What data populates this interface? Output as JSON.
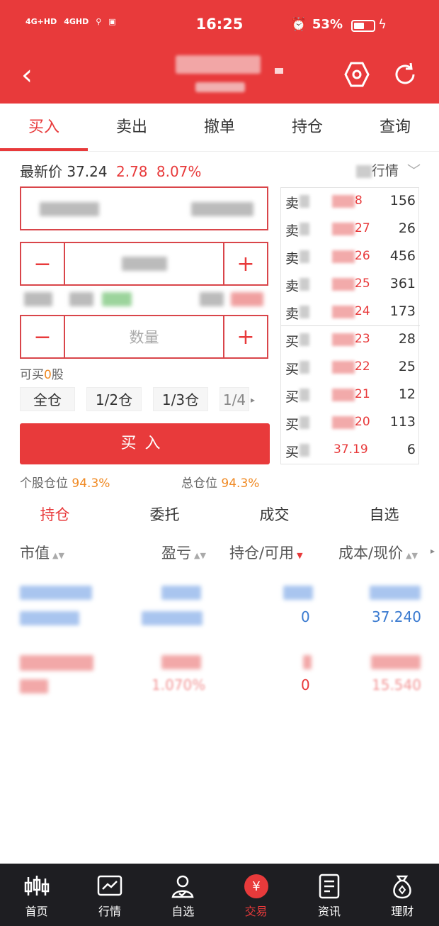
{
  "status_bar": {
    "network1": "4G+HD",
    "network2": "4GHD",
    "time": "16:25",
    "battery": "53%",
    "battery_level": 0.53
  },
  "header": {
    "back_icon": "back-arrow-icon",
    "settings_icon": "hexagon-settings-icon",
    "refresh_icon": "refresh-icon"
  },
  "tabs": [
    {
      "label": "买入"
    },
    {
      "label": "卖出"
    },
    {
      "label": "撤单"
    },
    {
      "label": "持仓"
    },
    {
      "label": "查询"
    }
  ],
  "price": {
    "label": "最新价",
    "last": "37.24",
    "change": "2.78",
    "change_pct": "8.07%",
    "quote_switch": "行情"
  },
  "order_form": {
    "minus": "−",
    "plus": "+",
    "quantity_placeholder": "数量",
    "can_buy_prefix": "可买",
    "can_buy_value": "0",
    "can_buy_suffix": "股",
    "position_buttons": [
      "全仓",
      "1/2仓",
      "1/3仓",
      "1/4"
    ],
    "buy_button": "买入",
    "single_ratio_label": "个股仓位",
    "single_ratio_value": "94.3%",
    "total_ratio_label": "总仓位",
    "total_ratio_value": "94.3%"
  },
  "order_book": {
    "rows": [
      {
        "label": "卖",
        "price_suffix": "8",
        "volume": "156"
      },
      {
        "label": "卖",
        "price_suffix": "27",
        "volume": "26"
      },
      {
        "label": "卖",
        "price_suffix": "26",
        "volume": "456"
      },
      {
        "label": "卖",
        "price_suffix": "25",
        "volume": "361"
      },
      {
        "label": "卖",
        "price_suffix": "24",
        "volume": "173"
      },
      {
        "label": "买",
        "price_suffix": "23",
        "volume": "28"
      },
      {
        "label": "买",
        "price_suffix": "22",
        "volume": "25"
      },
      {
        "label": "买",
        "price_suffix": "21",
        "volume": "12"
      },
      {
        "label": "买",
        "price_suffix": "20",
        "volume": "113"
      },
      {
        "label": "买",
        "price_suffix": "37.19",
        "volume": "6"
      }
    ]
  },
  "portfolio_tabs": [
    {
      "label": "持仓"
    },
    {
      "label": "委托"
    },
    {
      "label": "成交"
    },
    {
      "label": "自选"
    }
  ],
  "columns": {
    "market_value": "市值",
    "pnl": "盈亏",
    "holding": "持仓/可用",
    "cost": "成本/现价"
  },
  "holdings": [
    {
      "available": "0",
      "current_price": "37.240"
    },
    {
      "available": "0",
      "current_price": "15.540",
      "pnl_pct_suffix": "1.070%"
    }
  ],
  "bottom_nav": [
    {
      "label": "首页",
      "icon": "candlestick-icon"
    },
    {
      "label": "行情",
      "icon": "chart-icon"
    },
    {
      "label": "自选",
      "icon": "user-icon"
    },
    {
      "label": "交易",
      "icon": "yuan-icon"
    },
    {
      "label": "资讯",
      "icon": "document-icon"
    },
    {
      "label": "理财",
      "icon": "money-bag-icon"
    }
  ],
  "colors": {
    "brand_red": "#e83a3b",
    "orange": "#f08a24",
    "blue": "#3b7bd0",
    "nav_bg": "#1e1e22"
  }
}
